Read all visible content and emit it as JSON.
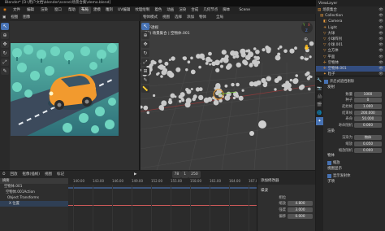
{
  "titlebar": {
    "title": "Blender* [D:\\用户文档\\blender\\scene\\场景合集\\demo.blend]",
    "minimize": "—",
    "maximize": "☐",
    "close": "✕"
  },
  "menubar": {
    "items": [
      "文件",
      "编辑",
      "渲染",
      "窗口",
      "帮助"
    ],
    "workspaces": [
      "布局",
      "建模",
      "雕刻",
      "UV编辑",
      "纹理绘制",
      "着色",
      "动画",
      "渲染",
      "合成",
      "几何节点",
      "脚本"
    ],
    "active_workspace": "布局",
    "scene": "Scene",
    "viewlayer": "ViewLayer"
  },
  "image_editor": {
    "header": [
      "视图",
      "图像"
    ],
    "image_name": "car_render.png"
  },
  "viewport": {
    "header": [
      "物体模式",
      "视图",
      "选择",
      "添加",
      "物体"
    ],
    "overlay_line1": "用户透视",
    "overlay_line2": "(78) 场景集合 | 空物体.001",
    "transform_label": "全局"
  },
  "outliner": {
    "items": [
      {
        "label": "场景集合",
        "icon": "collection-icon"
      },
      {
        "label": "Collection",
        "icon": "collection-icon"
      },
      {
        "label": "Camera",
        "icon": "camera-icon"
      },
      {
        "label": "Light",
        "icon": "light-icon"
      },
      {
        "label": "大球",
        "icon": "mesh-icon"
      },
      {
        "label": "小球阵列",
        "icon": "mesh-icon"
      },
      {
        "label": "小球.001",
        "icon": "mesh-icon"
      },
      {
        "label": "立方体",
        "icon": "mesh-icon"
      },
      {
        "label": "平面",
        "icon": "mesh-icon"
      },
      {
        "label": "空物体",
        "icon": "empty-icon"
      },
      {
        "label": "空物体.001",
        "icon": "empty-icon"
      },
      {
        "label": "粒子",
        "icon": "particle-icon"
      }
    ]
  },
  "properties": {
    "checkbox": "开启式遮挡剔除",
    "section1": "发射",
    "rows1": [
      {
        "label": "数量",
        "value": "1000"
      },
      {
        "label": "种子",
        "value": "0"
      },
      {
        "label": "起始帧",
        "value": "1.000"
      },
      {
        "label": "结束帧",
        "value": "200.000"
      },
      {
        "label": "寿命",
        "value": "50.000"
      },
      {
        "label": "寿命随机",
        "value": "0.000"
      }
    ],
    "section2": "渲染",
    "rows2": [
      {
        "label": "渲染为",
        "value": "物体"
      },
      {
        "label": "缩放",
        "value": "0.050"
      },
      {
        "label": "缩放随机",
        "value": "0.000"
      }
    ],
    "section3": "物体",
    "checkbox2": "缩放",
    "section4": "视图显示",
    "checkbox3": "显示发射体",
    "section5": "子项"
  },
  "timeline": {
    "header": [
      "回放",
      "抠像(插帧)",
      "视图",
      "标记"
    ],
    "current_frame": "78",
    "start": "1",
    "end": "250",
    "channels": [
      "摘要",
      "空物体.001",
      "空物体.001Action",
      "Object Transforms",
      "X 位置"
    ],
    "ticks": [
      "140.00",
      "143.00",
      "146.00",
      "149.00",
      "152.00",
      "155.00",
      "158.00",
      "161.00",
      "164.00",
      "167.00"
    ]
  },
  "popup": {
    "title": "添加修改器",
    "section": "噪波",
    "rows": [
      {
        "label": "缩放",
        "value": "4.800"
      },
      {
        "label": "强度",
        "value": "3.000"
      },
      {
        "label": "偏移",
        "value": "0.000"
      }
    ],
    "rows_label": "相位"
  }
}
